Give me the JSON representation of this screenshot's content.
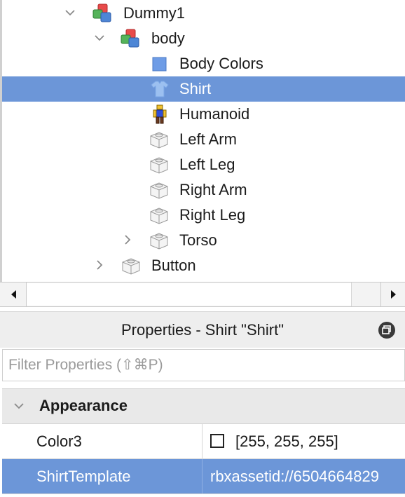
{
  "explorer": {
    "items": [
      {
        "label": "Dummy1",
        "icon": "model-icon",
        "expanded": true
      },
      {
        "label": "body",
        "icon": "model-icon",
        "expanded": true
      },
      {
        "label": "Body Colors",
        "icon": "body-colors-icon"
      },
      {
        "label": "Shirt",
        "icon": "shirt-icon",
        "selected": true
      },
      {
        "label": "Humanoid",
        "icon": "humanoid-icon"
      },
      {
        "label": "Left Arm",
        "icon": "part-icon"
      },
      {
        "label": "Left Leg",
        "icon": "part-icon"
      },
      {
        "label": "Right Arm",
        "icon": "part-icon"
      },
      {
        "label": "Right Leg",
        "icon": "part-icon"
      },
      {
        "label": "Torso",
        "icon": "part-icon",
        "expanded": false
      },
      {
        "label": "Button",
        "icon": "part-icon",
        "expanded": false
      }
    ]
  },
  "properties": {
    "title": "Properties - Shirt \"Shirt\"",
    "filter_placeholder": "Filter Properties (⇧⌘P)",
    "category": "Appearance",
    "rows": [
      {
        "name": "Color3",
        "value": "[255, 255, 255]",
        "swatch": "#ffffff"
      },
      {
        "name": "ShirtTemplate",
        "value": "rbxassetid://6504664829",
        "selected": true
      }
    ]
  },
  "colors": {
    "selection": "#6c96d8",
    "panel_header": "#eeeeee",
    "category_bg": "#e9e9e9"
  }
}
